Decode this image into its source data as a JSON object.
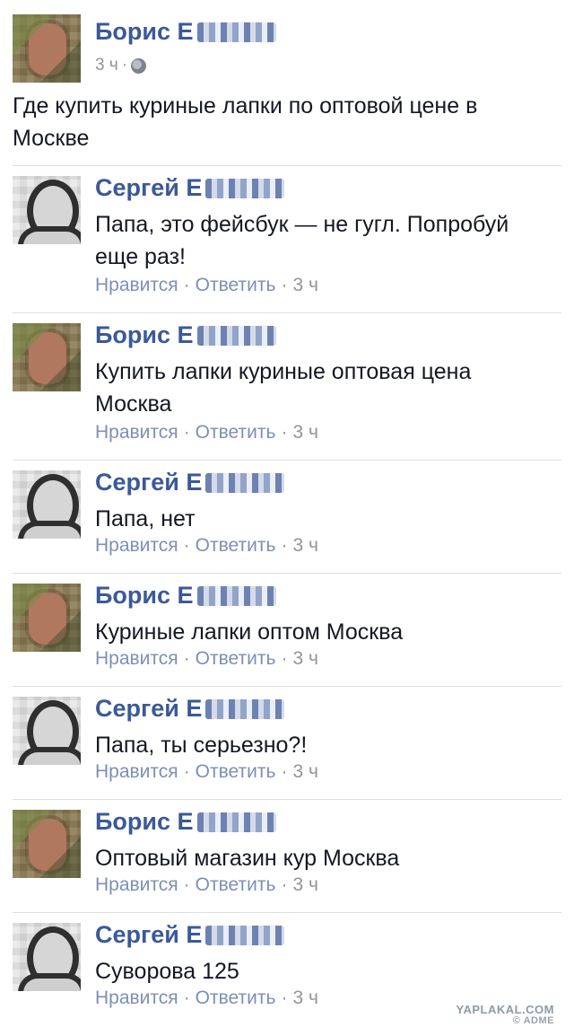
{
  "post": {
    "author": "Борис Е",
    "time": "3 ч",
    "text": "Где купить куриные лапки по оптовой цене в Москве"
  },
  "actions": {
    "like": "Нравится",
    "reply": "Ответить",
    "separator": "·"
  },
  "comments": [
    {
      "author": "Сергей Е",
      "text": "Папа, это фейсбук — не гугл. Попробуй еще раз!",
      "time": "3 ч"
    },
    {
      "author": "Борис Е",
      "text": "Купить лапки куриные оптовая цена Москва",
      "time": "3 ч"
    },
    {
      "author": "Сергей Е",
      "text": "Папа, нет",
      "time": "3 ч"
    },
    {
      "author": "Борис Е",
      "text": "Куриные лапки оптом Москва",
      "time": "3 ч"
    },
    {
      "author": "Сергей Е",
      "text": "Папа, ты серьезно?!",
      "time": "3 ч"
    },
    {
      "author": "Борис Е",
      "text": "Оптовый магазин кур Москва",
      "time": "3 ч"
    },
    {
      "author": "Сергей Е",
      "text": "Суворова 125",
      "time": "3 ч"
    }
  ],
  "watermark": {
    "site": "YAPLAKAL.COM",
    "source": "© ADME"
  }
}
